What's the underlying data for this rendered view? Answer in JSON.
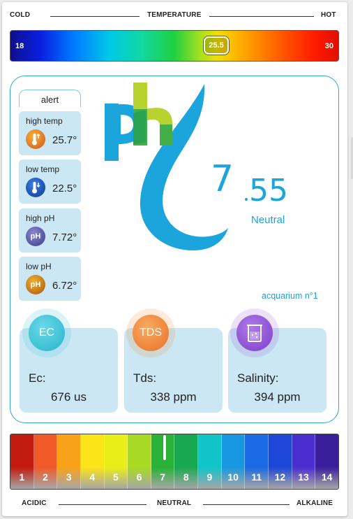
{
  "temperature": {
    "label_left": "COLD",
    "label_center": "TEMPERATURE",
    "label_right": "HOT",
    "scale_min": "18",
    "scale_max": "30",
    "current": "25.5",
    "current_value": 25.5
  },
  "alerts": {
    "title": "alert",
    "items": [
      {
        "label": "high temp",
        "value": "25.7°",
        "icon": "thermometer-up-icon",
        "color": "#d98a10"
      },
      {
        "label": "low temp",
        "value": "22.5°",
        "icon": "thermometer-down-icon",
        "color": "#1565c0"
      },
      {
        "label": "high pH",
        "value": "7.72°",
        "icon_text": "pH",
        "color": "#5f5fa8"
      },
      {
        "label": "low pH",
        "value": "6.72°",
        "icon_text": "pH",
        "color": "#c8780e"
      }
    ]
  },
  "ph": {
    "logo_text": "ph",
    "value_int": "7",
    "value_dec": "55",
    "status": "Neutral",
    "tank": "acquarium n°1"
  },
  "metrics": [
    {
      "badge": "EC",
      "label": "Ec:",
      "value": "676 us",
      "color": "#3fc4d8"
    },
    {
      "badge": "TDS",
      "label": "Tds:",
      "value": "338 ppm",
      "color": "#f08a3a"
    },
    {
      "badge_icon": "beaker-icon",
      "label": "Salinity:",
      "value": "394 ppm",
      "color": "#8f5ad6"
    }
  ],
  "ph_scale": {
    "numbers": [
      "1",
      "2",
      "3",
      "4",
      "5",
      "6",
      "7",
      "8",
      "9",
      "10",
      "11",
      "12",
      "13",
      "14"
    ],
    "colors": [
      "#c21a0e",
      "#f05a28",
      "#f8a21a",
      "#fbe41a",
      "#e8ef18",
      "#a8da25",
      "#28b238",
      "#18a850",
      "#10c4c8",
      "#1898e0",
      "#1a6ae6",
      "#1e48d8",
      "#4a2ed0",
      "#3a1f9a"
    ],
    "current_value": 7,
    "label_left": "ACIDIC",
    "label_center": "NEUTRAL",
    "label_right": "ALKALINE"
  }
}
